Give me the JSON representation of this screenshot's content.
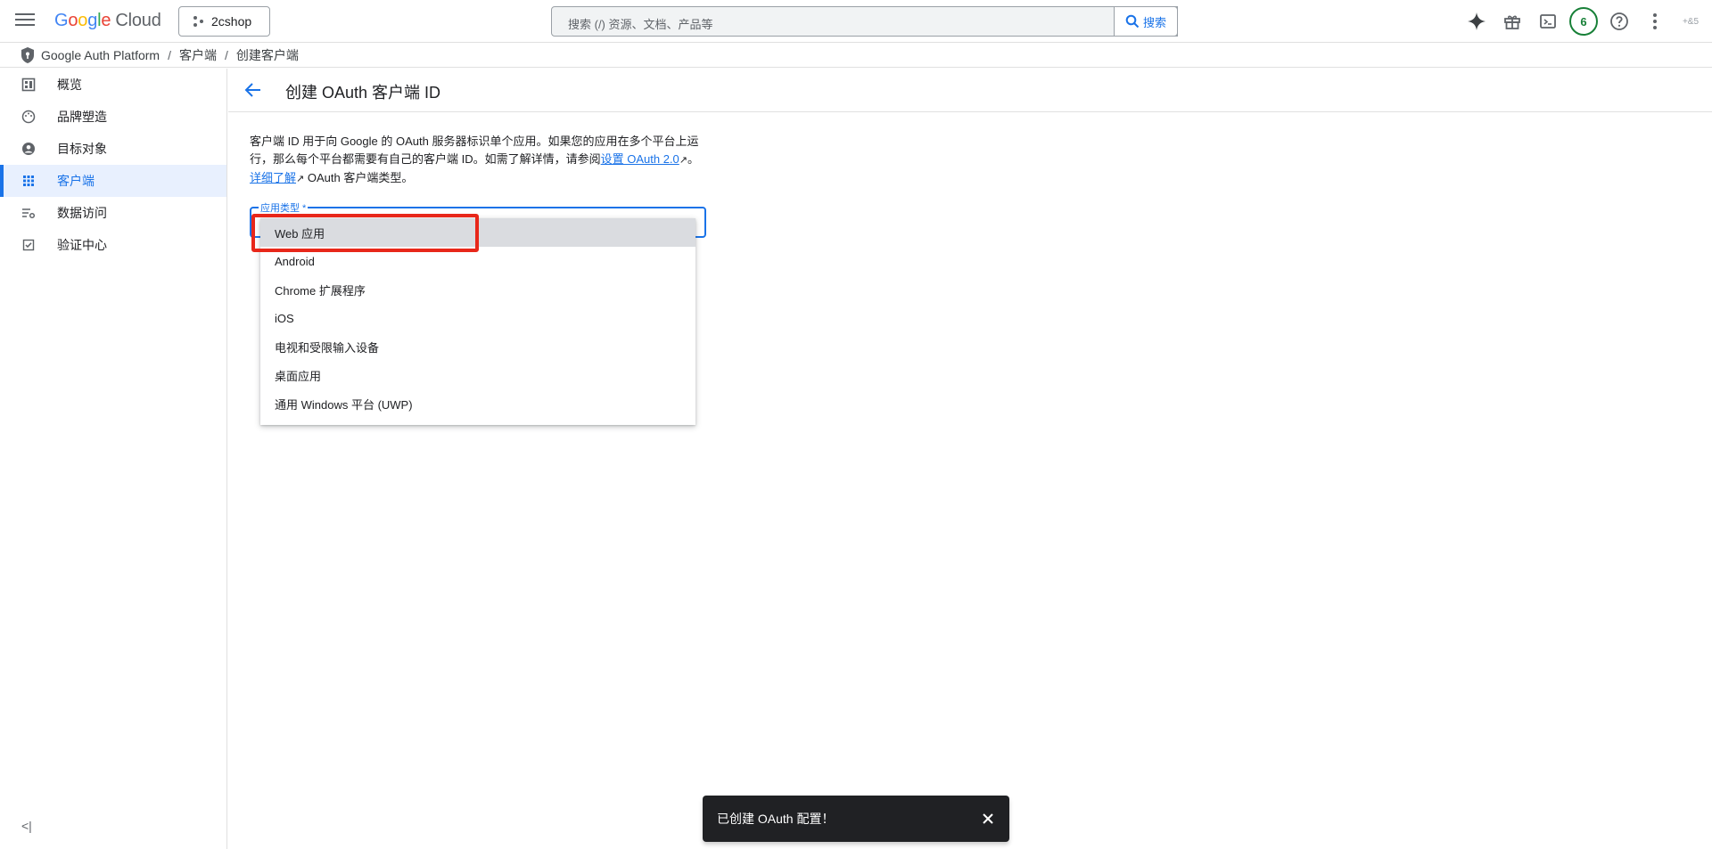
{
  "app": {
    "logo_parts": [
      "G",
      "o",
      "o",
      "g",
      "l",
      "e"
    ],
    "logo_suffix": "Cloud",
    "project": "2cshop",
    "search_placeholder": "搜索 (/) 资源、文档、产品等",
    "search_button": "搜索",
    "notification_count": "6",
    "user_avatar_text": "+&5"
  },
  "breadcrumb": [
    "Google Auth Platform",
    "客户端",
    "创建客户端"
  ],
  "breadcrumb_sep": "/",
  "sidebar": {
    "items": [
      {
        "label": "概览",
        "icon": "dashboard-icon"
      },
      {
        "label": "品牌塑造",
        "icon": "palette-icon"
      },
      {
        "label": "目标对象",
        "icon": "account-circle-icon"
      },
      {
        "label": "客户端",
        "icon": "grid-icon",
        "active": true
      },
      {
        "label": "数据访问",
        "icon": "list-settings-icon"
      },
      {
        "label": "验证中心",
        "icon": "check-box-icon"
      }
    ],
    "collapse_label": "<|"
  },
  "page": {
    "title": "创建 OAuth 客户端 ID",
    "description_part1": "客户端 ID 用于向 Google 的 OAuth 服务器标识单个应用。如果您的应用在多个平台上运行，那么每个平台都需要有自己的客户端 ID。如需了解详情，请参阅",
    "link1": "设置 OAuth 2.0",
    "description_part2": "。",
    "link2": "详细了解",
    "description_part3": "OAuth 客户端类型。",
    "field_label": "应用类型 *"
  },
  "dropdown": {
    "options": [
      "Web 应用",
      "Android",
      "Chrome 扩展程序",
      "iOS",
      "电视和受限输入设备",
      "桌面应用",
      "通用 Windows 平台 (UWP)"
    ],
    "highlighted_index": 0
  },
  "snackbar": {
    "message": "已创建 OAuth 配置！"
  },
  "colors": {
    "accent": "#1a73e8",
    "highlight_box": "#e8271a",
    "badge_green": "#188038"
  }
}
